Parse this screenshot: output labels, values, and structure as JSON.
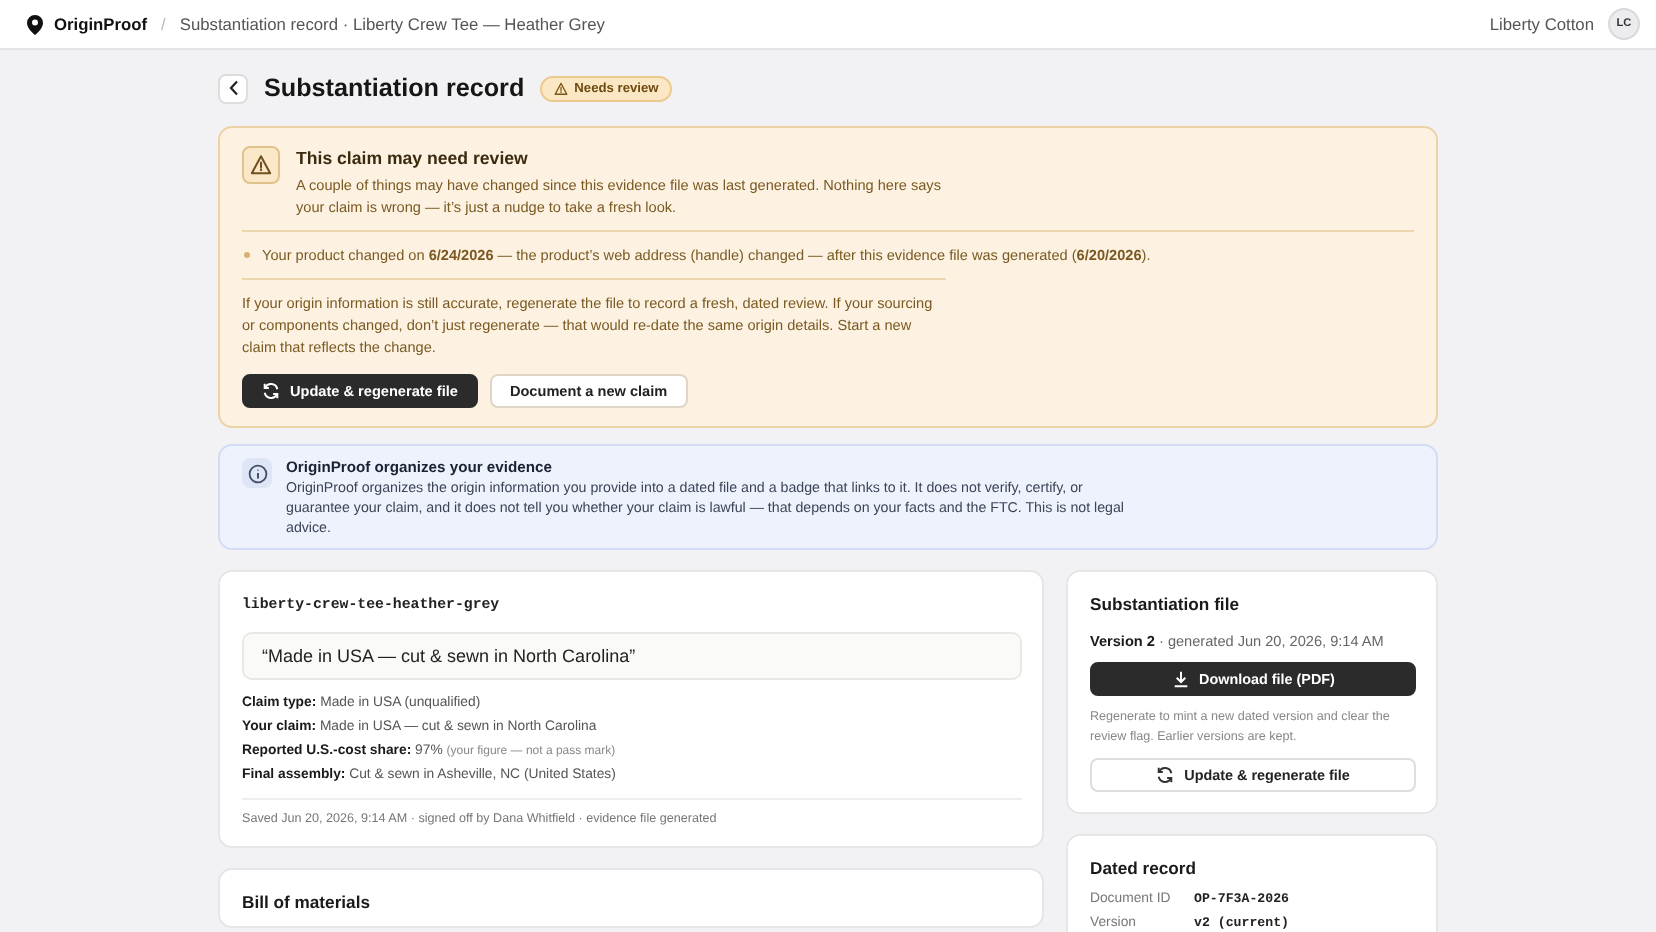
{
  "topbar": {
    "brand": "OriginProof",
    "separator": "/",
    "breadcrumb": "Substantiation record · Liberty Crew Tee — Heather Grey",
    "account": "Liberty Cotton",
    "avatar": "LC"
  },
  "header": {
    "title": "Substantiation record",
    "badge": "Needs review"
  },
  "alert": {
    "title": "This claim may need review",
    "text": "A couple of things may have changed since this evidence file was last generated. Nothing here says your claim is wrong — it’s just a nudge to take a fresh look.",
    "changes": [
      "Your product changed on **6/24/2026** — the product’s web address (handle) changed — after this evidence file was generated (**6/20/2026**)."
    ],
    "advice": "If your origin information is still accurate, regenerate the file to record a fresh, dated review. If your sourcing or components changed, don’t just regenerate — that would re-date the same origin details. Start a new claim that reflects the change.",
    "buttons": [
      {
        "label": "Update & regenerate file",
        "kind": "primary"
      },
      {
        "label": "Document a new claim",
        "kind": "secondary"
      }
    ]
  },
  "info": {
    "title": "OriginProof organizes your evidence",
    "text": "OriginProof organizes the origin information you provide into a dated file and a badge that links to it. It does not verify, certify, or guarantee your claim, and it does not tell you whether your claim is lawful — that depends on your facts and the FTC. This is not legal advice."
  },
  "claim": {
    "handle": "liberty-crew-tee-heather-grey",
    "quote": "“Made in USA — cut & sewn in North Carolina”",
    "fields": [
      {
        "label": "Claim type:",
        "value": "Made in USA (unqualified)"
      },
      {
        "label": "Your claim:",
        "value": "Made in USA — cut & sewn in North Carolina"
      },
      {
        "label": "Reported U.S.-cost share:",
        "value": "97%",
        "note": "(your figure — not a pass mark)"
      },
      {
        "label": "Final assembly:",
        "value": "Cut & sewn in Asheville, NC (United States)"
      }
    ],
    "footer": "Saved Jun 20, 2026, 9:14 AM · signed off by Dana Whitfield · evidence file generated"
  },
  "bom": {
    "title": "Bill of materials"
  },
  "file": {
    "title": "Substantiation file",
    "version": "Version 2",
    "generated": "· generated Jun 20, 2026, 9:14 AM",
    "download": "Download file (PDF)",
    "note": "Regenerate to mint a new dated version and clear the review flag. Earlier versions are kept.",
    "regenerate": "Update & regenerate file"
  },
  "record": {
    "title": "Dated record",
    "rows": [
      {
        "label": "Document ID",
        "value": "OP-7F3A-2026"
      },
      {
        "label": "Version",
        "value": "v2 (current)"
      }
    ]
  }
}
